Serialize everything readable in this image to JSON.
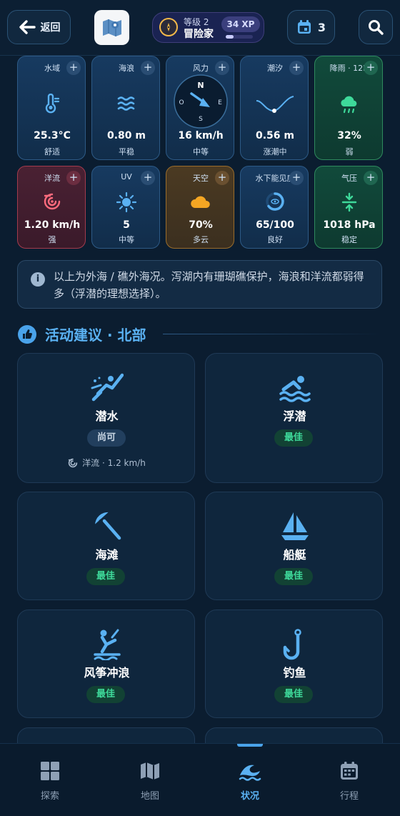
{
  "header": {
    "back_label": "返回",
    "level_label": "等级 2",
    "level_title": "冒险家",
    "xp_label": "34 XP",
    "xp_progress": 0.3,
    "calendar_count": "3"
  },
  "metrics": [
    {
      "label": "水域",
      "value": "25.3°C",
      "sub": "舒适",
      "icon": "thermometer-icon",
      "tone": "blue"
    },
    {
      "label": "海浪",
      "value": "0.80 m",
      "sub": "平稳",
      "icon": "waves-icon",
      "tone": "blue"
    },
    {
      "label": "风力",
      "value": "16 km/h",
      "sub": "中等",
      "icon": "wind-compass-icon",
      "tone": "blue",
      "compass": {
        "n": "N",
        "e": "E",
        "s": "S",
        "w": "O"
      }
    },
    {
      "label": "潮汐",
      "value": "0.56 m",
      "sub": "涨潮中",
      "icon": "tide-curve-icon",
      "tone": "blue"
    },
    {
      "label": "降雨 · 12H",
      "value": "32%",
      "sub": "弱",
      "icon": "rain-cloud-icon",
      "tone": "green"
    },
    {
      "label": "洋流",
      "value": "1.20 km/h",
      "sub": "强",
      "icon": "current-swirl-icon",
      "tone": "red"
    },
    {
      "label": "UV",
      "value": "5",
      "sub": "中等",
      "icon": "sun-icon",
      "tone": "blue"
    },
    {
      "label": "天空",
      "value": "70%",
      "sub": "多云",
      "icon": "cloud-icon",
      "tone": "amber"
    },
    {
      "label": "水下能见度",
      "value": "65/100",
      "sub": "良好",
      "icon": "visibility-ring-icon",
      "tone": "blue"
    },
    {
      "label": "气压",
      "value": "1018 hPa",
      "sub": "稳定",
      "icon": "pressure-icon",
      "tone": "green"
    }
  ],
  "info": {
    "text": "以上为外海 / 礁外海况。泻湖内有珊瑚礁保护，海浪和洋流都弱得多（浮潜的理想选择）。"
  },
  "section": {
    "title": "活动建议 · 北部"
  },
  "activities": [
    {
      "name": "潜水",
      "badge": "尚可",
      "status": "ok",
      "icon": "diving-icon",
      "note": "洋流 · 1.2 km/h"
    },
    {
      "name": "浮潜",
      "badge": "最佳",
      "status": "best",
      "icon": "swimming-icon"
    },
    {
      "name": "海滩",
      "badge": "最佳",
      "status": "best",
      "icon": "beach-umbrella-icon"
    },
    {
      "name": "船艇",
      "badge": "最佳",
      "status": "best",
      "icon": "sailboat-icon"
    },
    {
      "name": "风筝冲浪",
      "badge": "最佳",
      "status": "best",
      "icon": "kitesurf-icon"
    },
    {
      "name": "钓鱼",
      "badge": "最佳",
      "status": "best",
      "icon": "fishing-hook-icon"
    }
  ],
  "nav": [
    {
      "label": "探索",
      "icon": "grid-icon",
      "active": false
    },
    {
      "label": "地图",
      "icon": "map-icon",
      "active": false
    },
    {
      "label": "状况",
      "icon": "wave-icon",
      "active": true
    },
    {
      "label": "行程",
      "icon": "calendar-icon",
      "active": false
    }
  ],
  "colors": {
    "background": "#0b1d30",
    "accent": "#4aa3ea",
    "best_green": "#3ed99a"
  }
}
